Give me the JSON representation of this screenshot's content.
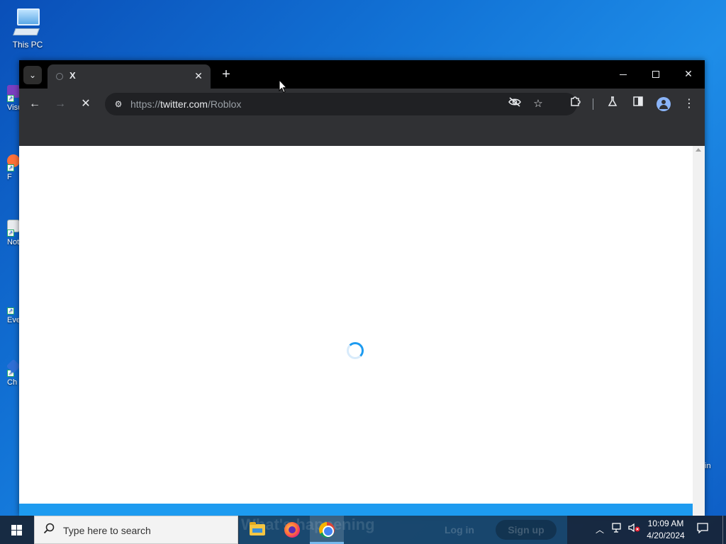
{
  "desktop": {
    "icons": [
      {
        "label": "This PC"
      },
      {
        "label": "Visu"
      },
      {
        "label": "F"
      },
      {
        "label": "Not"
      },
      {
        "label": "Eve"
      },
      {
        "label": "Ch"
      }
    ],
    "right_partial_label": "in"
  },
  "browser": {
    "tab": {
      "title": "X",
      "close_glyph": "✕"
    },
    "new_tab_glyph": "+",
    "window_controls": {
      "close_glyph": "✕"
    },
    "toolbar": {
      "back_glyph": "←",
      "forward_glyph": "→",
      "stop_glyph": "✕",
      "url_scheme": "https://",
      "url_host": "twitter.com",
      "url_path": "/Roblox",
      "menu_glyph": "⋮"
    },
    "page": {
      "state": "loading"
    }
  },
  "taskbar": {
    "search_placeholder": "Type here to search",
    "ghost_heading": "What's happening",
    "ghost_login": "Log in",
    "ghost_signup": "Sign up",
    "time": "10:09 AM",
    "date": "4/20/2024"
  },
  "icons": {
    "accent": "#1d9bf0",
    "chrome_dark": "#303134",
    "taskbar_bg": "#18202e"
  }
}
